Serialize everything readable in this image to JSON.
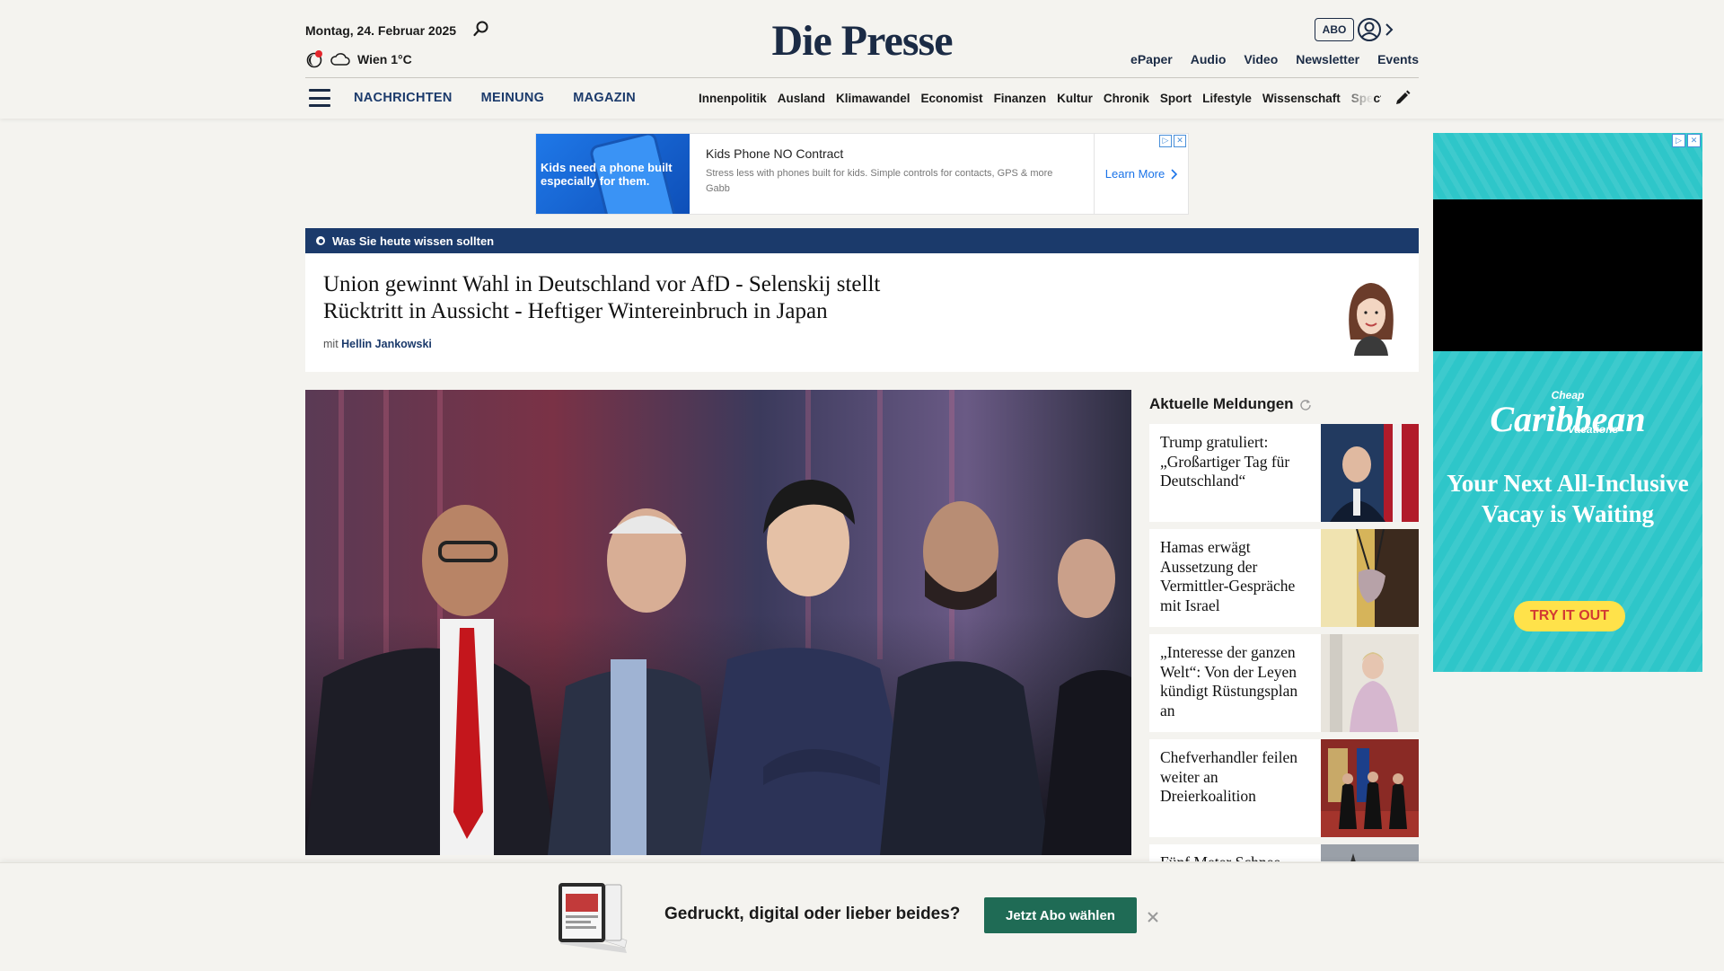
{
  "header": {
    "date": "Montag, 24. Februar 2025",
    "weather": "Wien 1°C",
    "logo": "Die Presse",
    "abo_label": "ABO",
    "links": [
      "ePaper",
      "Audio",
      "Video",
      "Newsletter",
      "Events"
    ]
  },
  "nav": {
    "main": [
      "NACHRICHTEN",
      "MEINUNG",
      "MAGAZIN"
    ],
    "sections": [
      "Innenpolitik",
      "Ausland",
      "Klimawandel",
      "Economist",
      "Finanzen",
      "Kultur",
      "Chronik",
      "Sport",
      "Lifestyle",
      "Wissenschaft",
      "Spectrum"
    ]
  },
  "top_ad": {
    "image_text": "Kids need a phone built especially for them.",
    "title": "Kids Phone NO Contract",
    "description": "Stress less with phones built for kids. Simple controls for contacts, GPS & more",
    "advertiser": "Gabb",
    "cta": "Learn More"
  },
  "briefing": {
    "label": "Was Sie heute wissen sollten",
    "headline": "Union gewinnt Wahl in Deutschland vor AfD - Selenskij stellt Rücktritt in Aussicht - Heftiger Wintereinbruch in Japan",
    "by_prefix": "mit",
    "author": "Hellin Jankowski"
  },
  "news": {
    "title": "Aktuelle Meldungen",
    "items": [
      {
        "headline": "Trump gratuliert: „Großartiger Tag für Deutschland“"
      },
      {
        "headline": "Hamas erwägt Aussetzung der Vermittler-Gespräche mit Israel"
      },
      {
        "headline": "„Interesse der ganzen Welt“: Von der Leyen kündigt Rüstungsplan an"
      },
      {
        "headline": "Chefverhandler feilen weiter an Dreierkoalition"
      },
      {
        "headline": "Fünf Meter Schnee"
      }
    ]
  },
  "side_ad": {
    "brand_small": "Cheap",
    "brand": "Caribbean",
    "brand_sub": "Vacations",
    "text": "Your Next All-Inclusive Vacay is Waiting",
    "cta": "TRY IT OUT"
  },
  "banner": {
    "text": "Gedruckt, digital oder lieber beides?",
    "button": "Jetzt Abo wählen"
  },
  "colors": {
    "brand_navy": "#1b3a6b",
    "logo": "#1b2b45",
    "cta_green": "#1f6b55",
    "background": "#f4f3ef"
  }
}
